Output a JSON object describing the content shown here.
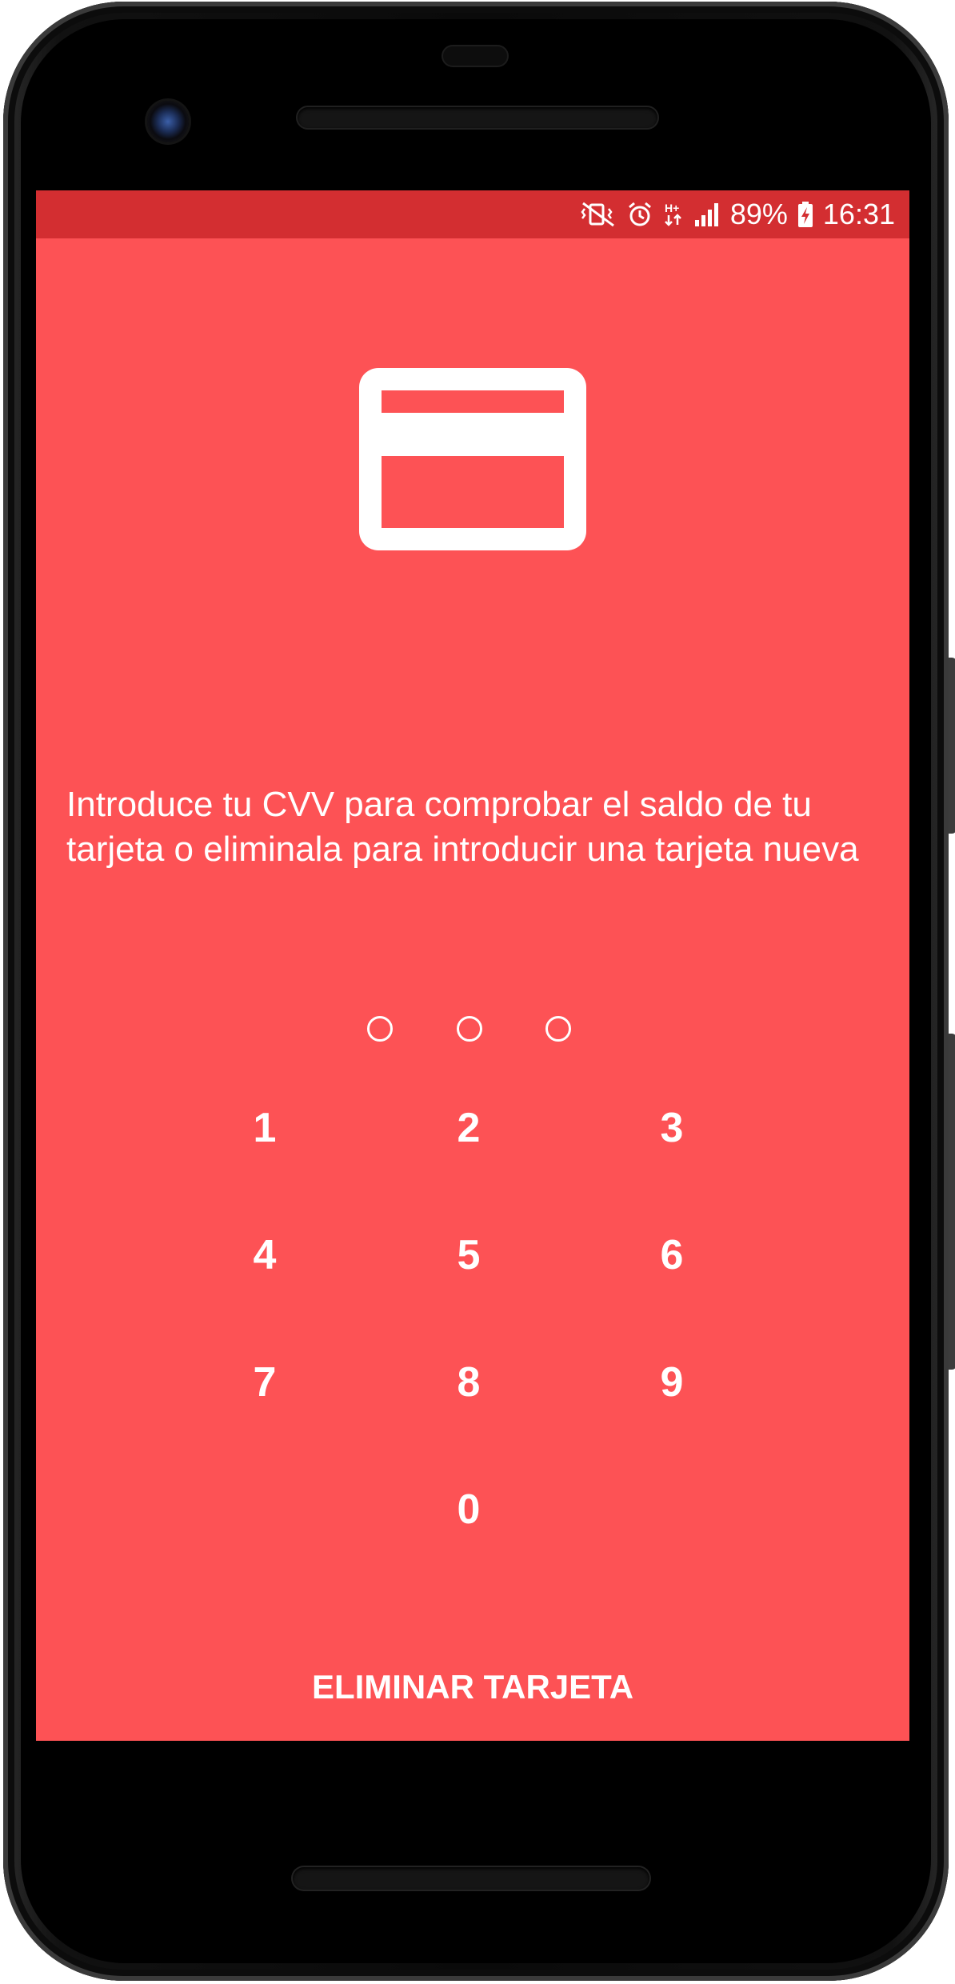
{
  "status_bar": {
    "battery_percent": "89%",
    "time": "16:31",
    "icons": [
      "vibrate-mute-icon",
      "alarm-icon",
      "network-hplus-icon",
      "signal-icon",
      "battery-charging-icon"
    ]
  },
  "card_icon": "credit-card-icon",
  "message": "Introduce tu CVV para comprobar el saldo de tu tarjeta o eliminala para introducir una tarjeta nueva",
  "pin": {
    "length": 3,
    "filled": 0
  },
  "keypad": {
    "k1": "1",
    "k2": "2",
    "k3": "3",
    "k4": "4",
    "k5": "5",
    "k6": "6",
    "k7": "7",
    "k8": "8",
    "k9": "9",
    "k0": "0"
  },
  "delete_card_label": "ELIMINAR TARJETA",
  "colors": {
    "background": "#fd5255",
    "status_bar": "#d32e31",
    "foreground": "#ffffff"
  }
}
